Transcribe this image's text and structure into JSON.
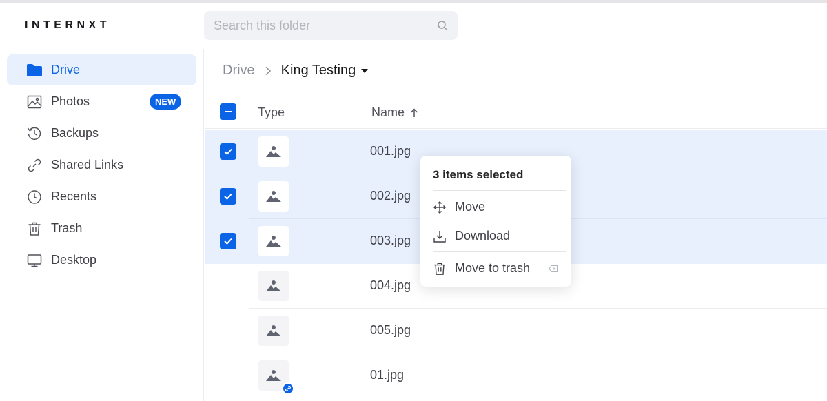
{
  "app": {
    "logo": "INTERNXT"
  },
  "search": {
    "placeholder": "Search this folder"
  },
  "sidebar": {
    "items": [
      {
        "label": "Drive",
        "icon": "folder-icon",
        "active": true
      },
      {
        "label": "Photos",
        "icon": "image-icon",
        "badge": "NEW"
      },
      {
        "label": "Backups",
        "icon": "history-icon"
      },
      {
        "label": "Shared Links",
        "icon": "link-icon"
      },
      {
        "label": "Recents",
        "icon": "clock-icon"
      },
      {
        "label": "Trash",
        "icon": "trash-icon"
      },
      {
        "label": "Desktop",
        "icon": "desktop-icon"
      }
    ]
  },
  "breadcrumb": {
    "root": "Drive",
    "current": "King Testing"
  },
  "columns": {
    "type": "Type",
    "name": "Name"
  },
  "files": [
    {
      "name": "001.jpg",
      "selected": true
    },
    {
      "name": "002.jpg",
      "selected": true
    },
    {
      "name": "003.jpg",
      "selected": true
    },
    {
      "name": "004.jpg",
      "selected": false
    },
    {
      "name": "005.jpg",
      "selected": false
    },
    {
      "name": "01.jpg",
      "selected": false,
      "shared": true
    }
  ],
  "context_menu": {
    "title": "3 items selected",
    "items": [
      {
        "label": "Move",
        "icon": "move-icon"
      },
      {
        "label": "Download",
        "icon": "download-icon"
      },
      {
        "label": "Move to trash",
        "icon": "trash-icon"
      }
    ]
  },
  "colors": {
    "accent": "#0b63e5",
    "selected_row": "#e8f0fe"
  }
}
